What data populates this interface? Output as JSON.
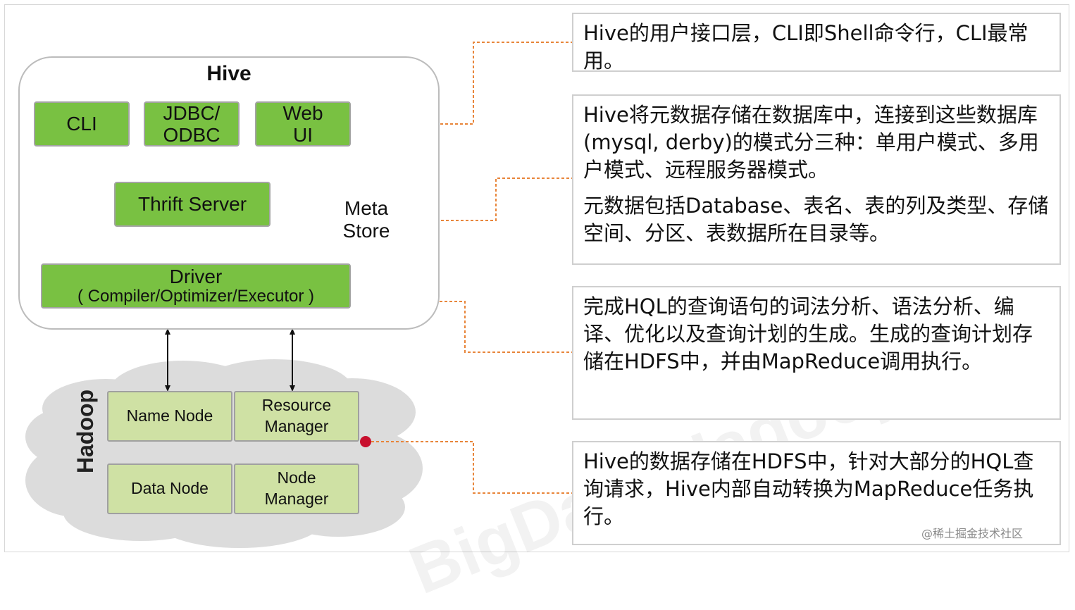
{
  "hive": {
    "title": "Hive",
    "cli": "CLI",
    "jdbc": "JDBC/\nODBC",
    "webui": "Web\nUI",
    "thrift": "Thrift Server",
    "metastore": "Meta\nStore",
    "driver": "Driver",
    "driver_sub": "( Compiler/Optimizer/Executor )"
  },
  "hadoop": {
    "label": "Hadoop",
    "name_node": "Name Node",
    "resource_manager": "Resource\nManager",
    "data_node": "Data Node",
    "node_manager": "Node\nManager"
  },
  "notes": {
    "interface": "Hive的用户接口层，CLI即Shell命令行，CLI最常用。",
    "metastore_1": "Hive将元数据存储在数据库中，连接到这些数据库(mysql, derby)的模式分三种：单用户模式、多用户模式、远程服务器模式。",
    "metastore_2": "元数据包括Database、表名、表的列及类型、存储空间、分区、表数据所在目录等。",
    "driver": "完成HQL的查询语句的词法分析、语法分析、编译、优化以及查询计划的生成。生成的查询计划存储在HDFS中，并由MapReduce调用执行。",
    "hadoop": "Hive的数据存储在HDFS中，针对大部分的HQL查询请求，Hive内部自动转换为MapReduce任务执行。"
  },
  "watermark": "@稀土掘金技术社区",
  "colors": {
    "green_box": "#79c142",
    "light_green_box": "#cfe1a4",
    "cloud": "#dcdcdc",
    "connector": "#e8853a",
    "dot": "#c8102e"
  }
}
